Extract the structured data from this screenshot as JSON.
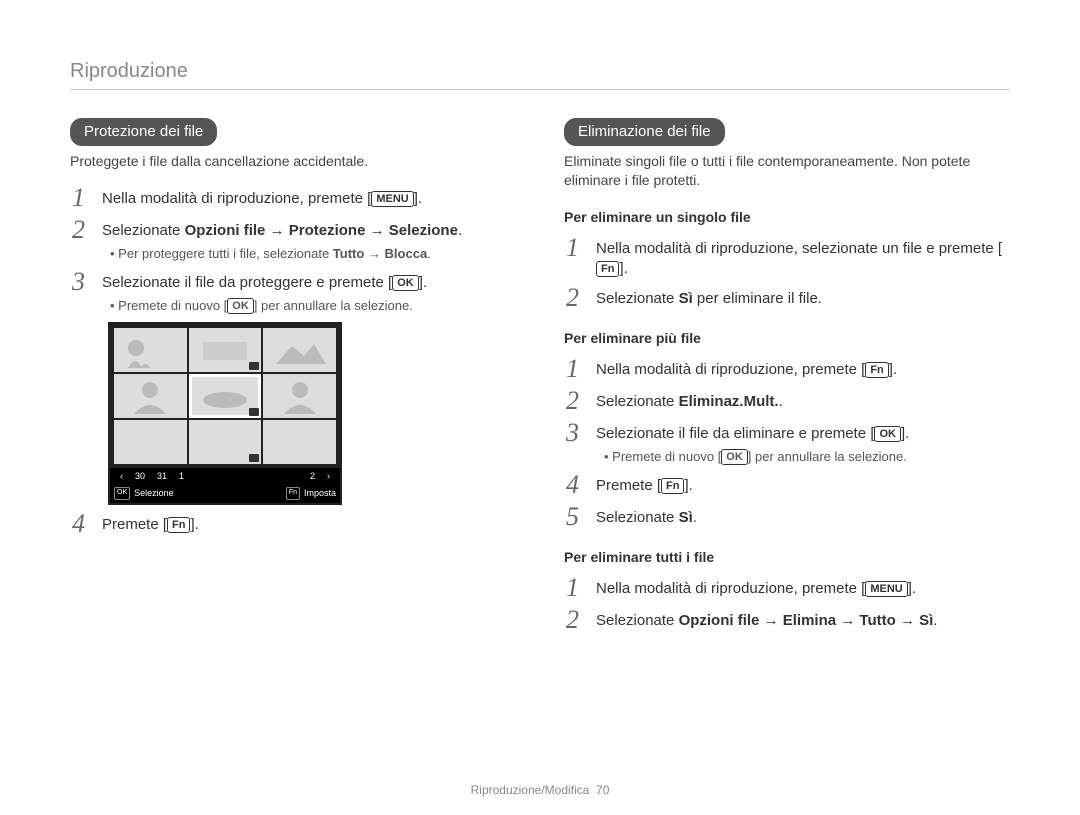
{
  "header": "Riproduzione",
  "left": {
    "pill": "Protezione dei file",
    "intro": "Proteggete i file dalla cancellazione accidentale.",
    "step1_pre": "Nella modalità di riproduzione, premete [",
    "step1_btn": "MENU",
    "step1_post": "].",
    "step2_pre": "Selezionate ",
    "step2_bold": "Opzioni file → Protezione → Selezione",
    "step2_post": ".",
    "step2_sub_pre": "Per proteggere tutti i file, selezionate ",
    "step2_sub_bold": "Tutto → Blocca",
    "step2_sub_post": ".",
    "step3_pre": "Selezionate il file da proteggere e premete [",
    "step3_btn": "OK",
    "step3_post": "].",
    "step3_sub_pre": "Premete di nuovo [",
    "step3_sub_btn": "OK",
    "step3_sub_post": "] per annullare la selezione.",
    "screenshot": {
      "dates": [
        "30",
        "31",
        "1",
        "2"
      ],
      "bb_key1": "OK",
      "bb_lbl1": "Selezione",
      "bb_key2": "Fn",
      "bb_lbl2": "Imposta"
    },
    "step4_pre": "Premete [",
    "step4_btn": "Fn",
    "step4_post": "]."
  },
  "right": {
    "pill": "Eliminazione dei file",
    "intro": "Eliminate singoli file o tutti i file contemporaneamente. Non potete eliminare i file protetti.",
    "sh1": "Per eliminare un singolo file",
    "s1a_pre": "Nella modalità di riproduzione, selezionate un file e premete [",
    "s1a_btn": "Fn",
    "s1a_post": "].",
    "s1b_pre": "Selezionate ",
    "s1b_bold": "Sì",
    "s1b_post": " per eliminare il file.",
    "sh2": "Per eliminare più file",
    "s2a_pre": "Nella modalità di riproduzione, premete [",
    "s2a_btn": "Fn",
    "s2a_post": "].",
    "s2b_pre": "Selezionate ",
    "s2b_bold": "Eliminaz.Mult.",
    "s2b_post": ".",
    "s2c_pre": "Selezionate il file da eliminare e premete [",
    "s2c_btn": "OK",
    "s2c_post": "].",
    "s2c_sub_pre": "Premete di nuovo [",
    "s2c_sub_btn": "OK",
    "s2c_sub_post": "] per annullare la selezione.",
    "s2d_pre": "Premete [",
    "s2d_btn": "Fn",
    "s2d_post": "].",
    "s2e_pre": "Selezionate ",
    "s2e_bold": "Sì",
    "s2e_post": ".",
    "sh3": "Per eliminare tutti i file",
    "s3a_pre": "Nella modalità di riproduzione, premete [",
    "s3a_btn": "MENU",
    "s3a_post": "].",
    "s3b_pre": "Selezionate ",
    "s3b_bold": "Opzioni file → Elimina → Tutto → Sì",
    "s3b_post": "."
  },
  "footer_label": "Riproduzione/Modifica",
  "footer_page": "70",
  "nums": {
    "n1": "1",
    "n2": "2",
    "n3": "3",
    "n4": "4",
    "n5": "5"
  }
}
